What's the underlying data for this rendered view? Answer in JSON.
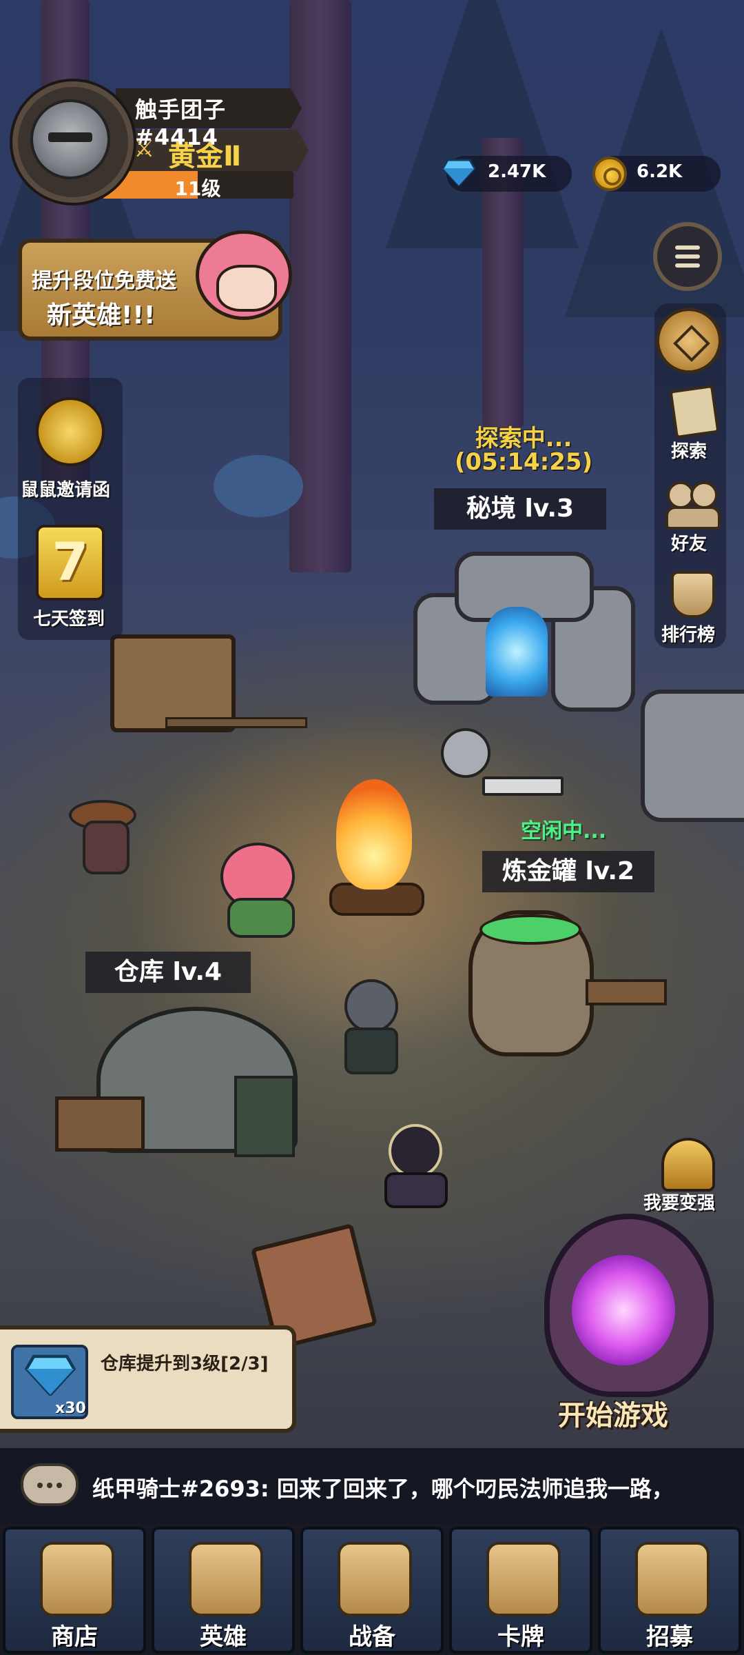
{
  "profile": {
    "name": "触手团子#4414",
    "rank": "黄金Ⅱ",
    "level": "11级",
    "level_progress": 0.5
  },
  "currencies": {
    "gems": "2.47K",
    "coins": "6.2K"
  },
  "promo": {
    "line1": "提升段位免费送",
    "line2": "新英雄!!!"
  },
  "left_events": [
    {
      "label": "鼠鼠邀请函"
    },
    {
      "label": "七天签到",
      "badge": "7"
    }
  ],
  "right_menu": [
    {
      "label": "探索"
    },
    {
      "label": "好友"
    },
    {
      "label": "排行榜"
    }
  ],
  "buildings": {
    "secret_realm": {
      "status": "探索中...",
      "timer": "(05:14:25)",
      "label": "秘境 lv.3"
    },
    "alchemy": {
      "status": "空闲中...",
      "label": "炼金罐 lv.2"
    },
    "warehouse": {
      "label": "仓库 lv.4"
    }
  },
  "task": {
    "text": "仓库提升到3级[2/3]",
    "reward_qty": "x30"
  },
  "boost_label": "我要变强",
  "start_game": "开始游戏",
  "chat": {
    "message": "纸甲骑士#2693: 回来了回来了，哪个叼民法师追我一路，"
  },
  "nav": [
    {
      "label": "商店"
    },
    {
      "label": "英雄"
    },
    {
      "label": "战备"
    },
    {
      "label": "卡牌"
    },
    {
      "label": "招募"
    }
  ],
  "colors": {
    "gold_text": "#f6d24a",
    "idle_green": "#4ef08a",
    "level_fill": "#f08a2c",
    "portal_purple": "#c02cf0"
  }
}
